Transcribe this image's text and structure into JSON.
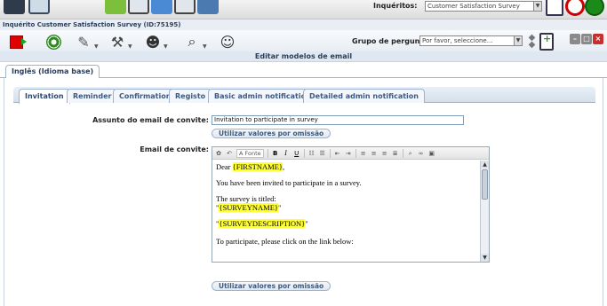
{
  "header": {
    "top_label": "Inquéritos:",
    "top_select_value": "Customer Satisfaction Survey",
    "survey_title": "Inquérito Customer Satisfaction Survey (ID:75195)",
    "question_group_label": "Grupo de perguntas:",
    "question_group_placeholder": "Por favor, seleccione..."
  },
  "panel": {
    "title": "Editar modelos de email"
  },
  "language_tab": {
    "label": "Inglês (Idioma base)"
  },
  "template_tabs": [
    {
      "label": "Invitation",
      "active": true
    },
    {
      "label": "Reminder",
      "active": false
    },
    {
      "label": "Confirmation",
      "active": false
    },
    {
      "label": "Registo",
      "active": false
    },
    {
      "label": "Basic admin notification",
      "active": false
    },
    {
      "label": "Detailed admin notification",
      "active": false
    }
  ],
  "form": {
    "subject_label": "Assunto do email de convite:",
    "subject_value": "Invitation to participate in survey",
    "reset_label": "Utilizar valores por omissão",
    "body_label": "Email de convite:",
    "body_reset_label": "Utilizar valores por omissão"
  },
  "editor": {
    "font_label": "Fonte",
    "lines": {
      "greeting_prefix": "Dear ",
      "firstname": "{FIRSTNAME}",
      "greeting_suffix": ",",
      "invited": "You have been invited to participate in a survey.",
      "titled": "The survey is titled:",
      "quote_open": "\"",
      "surveyname": "{SURVEYNAME}",
      "quote_close": "\"",
      "quote_open2": "\"",
      "surveydesc": "{SURVEYDESCRIPTION}",
      "quote_close2": "\"",
      "participate": "To participate, please click on the link below:"
    }
  },
  "colors": {
    "accent": "#2b3f5c",
    "tab_text": "#3d5a80",
    "highlight": "#ffff33",
    "close_red": "#c9302c"
  }
}
